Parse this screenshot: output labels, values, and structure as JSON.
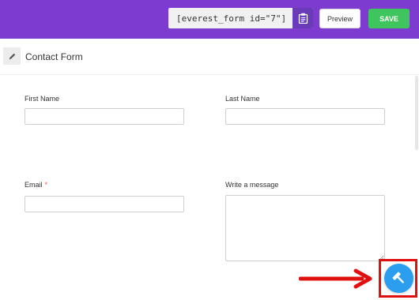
{
  "topbar": {
    "shortcode": "[everest_form id=\"7\"]",
    "preview_label": "Preview",
    "save_label": "SAVE",
    "bg_color": "#7e3bd0"
  },
  "form": {
    "title": "Contact Form",
    "fields": {
      "first_name_label": "First Name",
      "last_name_label": "Last Name",
      "email_label": "Email",
      "email_required_mark": "*",
      "message_label": "Write a message"
    }
  },
  "icons": {
    "copy": "clipboard-icon",
    "edit": "pencil-icon",
    "fab": "hammer-icon"
  },
  "colors": {
    "save": "#3ec55d",
    "fab": "#2b9ef0",
    "annotation": "#e01010"
  }
}
